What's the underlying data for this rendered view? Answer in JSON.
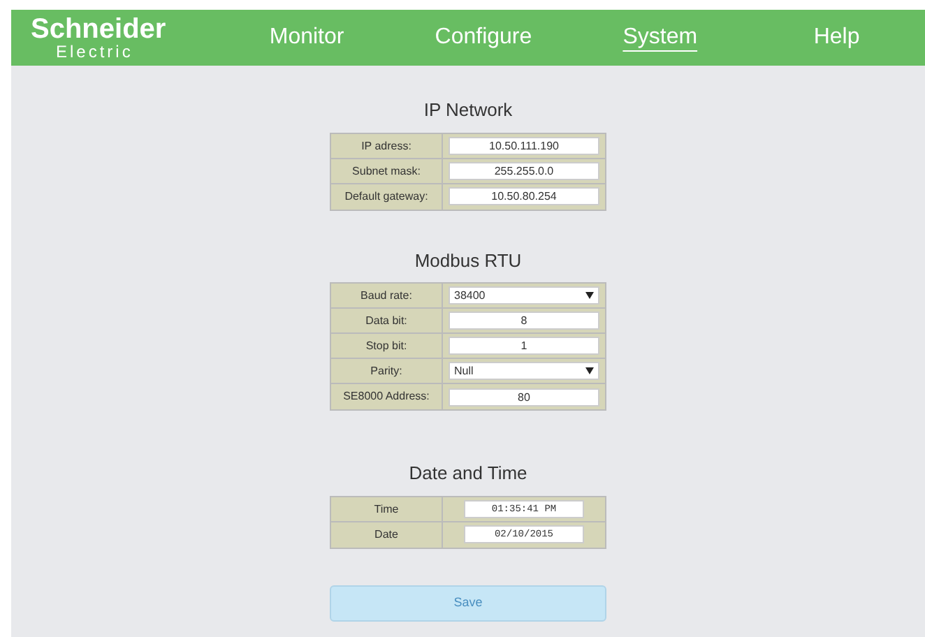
{
  "header": {
    "logo_top": "Schneider",
    "logo_bottom": "Electric",
    "nav": [
      {
        "label": "Monitor",
        "selected": false
      },
      {
        "label": "Configure",
        "selected": false
      },
      {
        "label": "System",
        "selected": true
      },
      {
        "label": "Help",
        "selected": false
      }
    ]
  },
  "sections": [
    {
      "title": "IP Network",
      "rows": [
        {
          "label": "IP adress:",
          "kind": "text",
          "value": "10.50.111.190"
        },
        {
          "label": "Subnet mask:",
          "kind": "text",
          "value": "255.255.0.0"
        },
        {
          "label": "Default gateway:",
          "kind": "text",
          "value": "10.50.80.254"
        }
      ]
    },
    {
      "title": "Modbus RTU",
      "rows": [
        {
          "label": "Baud rate:",
          "kind": "select",
          "value": "38400"
        },
        {
          "label": "Data bit:",
          "kind": "text",
          "value": "8"
        },
        {
          "label": "Stop bit:",
          "kind": "text",
          "value": "1"
        },
        {
          "label": "Parity:",
          "kind": "select",
          "value": "Null"
        },
        {
          "label": "SE8000 Address:",
          "kind": "text",
          "value": "80"
        }
      ]
    },
    {
      "title": "Date and Time",
      "rows": [
        {
          "label": "Time",
          "kind": "mono",
          "value": "01:35:41 PM"
        },
        {
          "label": "Date",
          "kind": "mono",
          "value": "02/10/2015"
        }
      ]
    }
  ],
  "save_button": "Save"
}
